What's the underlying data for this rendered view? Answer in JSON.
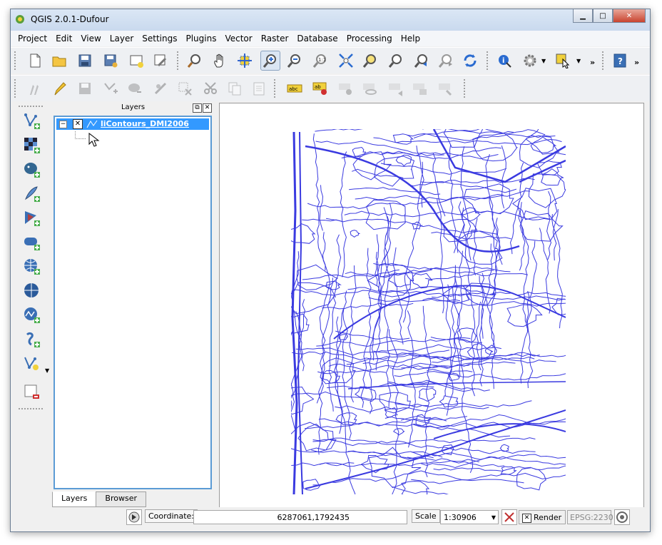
{
  "window": {
    "title": "QGIS 2.0.1-Dufour"
  },
  "menu": [
    "Project",
    "Edit",
    "View",
    "Layer",
    "Settings",
    "Plugins",
    "Vector",
    "Raster",
    "Database",
    "Processing",
    "Help"
  ],
  "toolbar_main": [
    {
      "name": "new-project-icon"
    },
    {
      "name": "open-project-icon"
    },
    {
      "name": "save-project-icon"
    },
    {
      "name": "save-as-icon"
    },
    {
      "name": "new-print-composer-icon"
    },
    {
      "name": "composer-manager-icon"
    },
    {
      "name": "pan-to-selected-icon"
    },
    {
      "name": "pan-hand-icon"
    },
    {
      "name": "pan-to-selection-icon"
    },
    {
      "name": "zoom-in-icon"
    },
    {
      "name": "zoom-out-icon"
    },
    {
      "name": "zoom-actual-size-icon"
    },
    {
      "name": "zoom-full-icon"
    },
    {
      "name": "zoom-to-selection-icon"
    },
    {
      "name": "zoom-to-layer-icon"
    },
    {
      "name": "zoom-last-icon"
    },
    {
      "name": "zoom-next-icon"
    },
    {
      "name": "refresh-icon"
    },
    {
      "name": "identify-icon"
    },
    {
      "name": "action-gear-icon"
    },
    {
      "name": "select-features-icon"
    },
    {
      "name": "help-icon"
    }
  ],
  "toolbar_edit": [
    {
      "name": "current-edits-icon"
    },
    {
      "name": "toggle-editing-icon"
    },
    {
      "name": "save-edits-icon"
    },
    {
      "name": "add-feature-icon"
    },
    {
      "name": "move-feature-icon"
    },
    {
      "name": "node-tool-icon"
    },
    {
      "name": "delete-selected-icon"
    },
    {
      "name": "cut-features-icon"
    },
    {
      "name": "copy-features-icon"
    },
    {
      "name": "paste-features-icon"
    },
    {
      "name": "label-abc-icon"
    },
    {
      "name": "pin-labels-icon"
    },
    {
      "name": "show-hide-labels-icon"
    },
    {
      "name": "move-label-icon"
    },
    {
      "name": "rotate-label-icon"
    },
    {
      "name": "change-label-icon"
    },
    {
      "name": "label-properties-icon"
    }
  ],
  "left_toolbar": [
    {
      "name": "add-vector-layer-icon"
    },
    {
      "name": "add-raster-layer-icon"
    },
    {
      "name": "add-postgis-layer-icon"
    },
    {
      "name": "add-spatialite-layer-icon"
    },
    {
      "name": "add-mssql-layer-icon"
    },
    {
      "name": "add-oracle-layer-icon"
    },
    {
      "name": "add-wms-layer-icon"
    },
    {
      "name": "add-wcs-layer-icon"
    },
    {
      "name": "add-wfs-layer-icon"
    },
    {
      "name": "add-delimited-text-icon"
    },
    {
      "name": "new-shapefile-icon"
    },
    {
      "name": "remove-layer-icon"
    }
  ],
  "layers_panel": {
    "title": "Layers",
    "layers": [
      {
        "name": "liContours_DMI2006",
        "visible": true
      }
    ],
    "tabs": [
      "Layers",
      "Browser"
    ]
  },
  "statusbar": {
    "coordinate_label": "Coordinate:",
    "coordinate_value": "6287061,1792435",
    "scale_label": "Scale",
    "scale_value": "1:30906",
    "render_label": "Render",
    "crs": "EPSG:2230"
  },
  "colors": {
    "contour": "#3a3ae0",
    "selection": "#3399ff"
  }
}
